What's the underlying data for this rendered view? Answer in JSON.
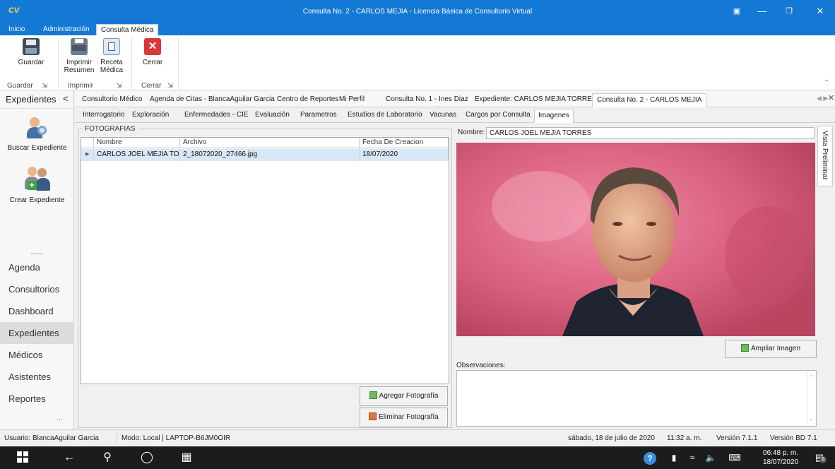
{
  "window": {
    "logo": "CV",
    "title": "Consulta No. 2 - CARLOS MEJIA - Licencia Básica de Consultorio Virtual"
  },
  "menu": [
    "Inicio",
    "Administración",
    "Consulta Médica"
  ],
  "ribbon": {
    "buttons": {
      "guardar": "Guardar",
      "imprimir_resumen_1": "Imprimir",
      "imprimir_resumen_2": "Resumen",
      "receta_1": "Receta",
      "receta_2": "Médica",
      "cerrar": "Cerrar"
    },
    "groups": {
      "guardar": "Guardar",
      "imprimir": "Imprimir",
      "cerrar": "Cerrar"
    }
  },
  "left": {
    "header": "Expedientes",
    "buscar": "Buscar Expediente",
    "crear": "Crear Expediente",
    "dots": "......",
    "nav": [
      "Agenda",
      "Consultorios",
      "Dashboard",
      "Expedientes",
      "Médicos",
      "Asistentes",
      "Reportes"
    ],
    "more": "..."
  },
  "tabs1": [
    "Consultorio Médico",
    "Agenda de Citas - BlancaAguilar Garcia",
    "Centro de Reportes",
    "Mi Perfil",
    "Consulta No. 1 - Ines Diaz",
    "Expediente: CARLOS MEJIA TORRES",
    "Consulta No. 2 - CARLOS MEJIA"
  ],
  "tabs2": [
    "Interrogatorio",
    "Exploración",
    "Enfermedades - CIE",
    "Evaluación",
    "Parametros",
    "Estudios de Laboratorio",
    "Vacunas",
    "Cargos por Consulta",
    "Imagenes"
  ],
  "fotos": {
    "group_label": "FOTOGRAFIAS",
    "columns": [
      "Nombre",
      "Archivo",
      "Fecha De Creacion"
    ],
    "rows": [
      {
        "nombre": "CARLOS JOEL MEJIA TOR...",
        "archivo": "2_18072020_27466.jpg",
        "fecha": "18/07/2020"
      }
    ],
    "agregar": "Agregar Fotografía",
    "eliminar": "Eliminar Fotografía"
  },
  "detail": {
    "nombre_label": "Nombre:",
    "nombre_value": "CARLOS JOEL MEJIA TORRES",
    "ampliar": "Ampliar Imagen",
    "observaciones_label": "Observaciones:",
    "side_tab": "Vista Preliminar"
  },
  "status": {
    "usuario": "Usuario: BlancaAguilar Garcia",
    "modo": "Modo: Local | LAPTOP-B6JM0OIR",
    "fecha": "sábado, 18 de julio de 2020",
    "hora": "11:32 a. m.",
    "version": "Versión  7.1.1",
    "version_bd": "Versión BD 7.1"
  },
  "taskbar": {
    "time": "06:48 p. m.",
    "date": "18/07/2020",
    "notif": "8"
  }
}
